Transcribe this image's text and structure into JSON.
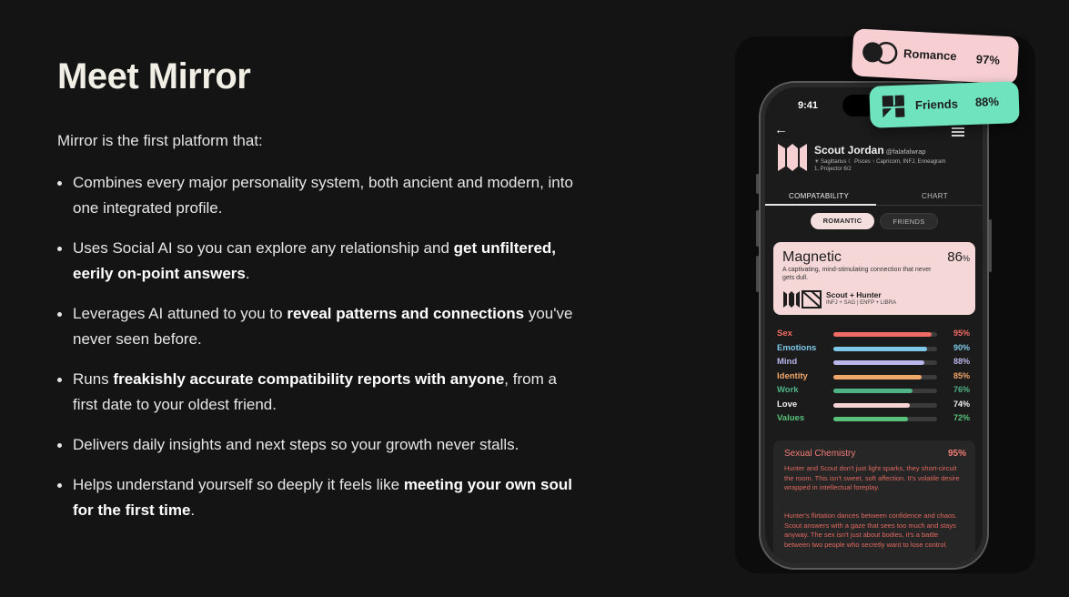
{
  "hero": {
    "title": "Meet Mirror",
    "intro": "Mirror is the first platform that:"
  },
  "bullets": [
    {
      "parts": [
        {
          "text": "Combines every major personality system, both ancient and modern, into one integrated profile.",
          "bold": false
        }
      ]
    },
    {
      "parts": [
        {
          "text": "Uses Social AI so you can explore any relationship and ",
          "bold": false
        },
        {
          "text": "get unfiltered, eerily on-point answers",
          "bold": true
        },
        {
          "text": ".",
          "bold": false
        }
      ]
    },
    {
      "parts": [
        {
          "text": "Leverages AI attuned to you to ",
          "bold": false
        },
        {
          "text": "reveal patterns and connections",
          "bold": true
        },
        {
          "text": " you've never seen before.",
          "bold": false
        }
      ]
    },
    {
      "parts": [
        {
          "text": "Runs ",
          "bold": false
        },
        {
          "text": "freakishly accurate compatibility reports with anyone",
          "bold": true
        },
        {
          "text": ", from a first date to your oldest friend.",
          "bold": false
        }
      ]
    },
    {
      "parts": [
        {
          "text": "Delivers daily insights and next steps so your growth never stalls.",
          "bold": false
        }
      ]
    },
    {
      "parts": [
        {
          "text": "Helps understand yourself so deeply it feels like ",
          "bold": false
        },
        {
          "text": "meeting your own soul for the first time",
          "bold": true
        },
        {
          "text": ".",
          "bold": false
        }
      ]
    }
  ],
  "pills": {
    "romance": {
      "label": "Romance",
      "pct": "97%",
      "color": "#f7cfd3"
    },
    "friends": {
      "label": "Friends",
      "pct": "88%",
      "color": "#6fe3be"
    }
  },
  "phone": {
    "time": "9:41",
    "profile": {
      "name": "Scout Jordan",
      "handle": "@falafalwrap",
      "meta": "☀ Sagittarius ☾ Pisces ↑ Capricorn, INFJ, Enneagram 1, Projector 6/2"
    },
    "tabs": {
      "compatibility": "COMPATABILITY",
      "chart": "CHART"
    },
    "segments": {
      "romantic": "ROMANTIC",
      "friends": "FRIENDS"
    },
    "card": {
      "title": "Magnetic",
      "pct": "86",
      "pct_unit": "%",
      "desc": "A captivating, mind-stimulating connection that never gets dull.",
      "pair": "Scout + Hunter",
      "pair_sub": "INFJ + SAG | ENFP + LIBRA"
    },
    "metrics": [
      {
        "label": "Sex",
        "pct": "95%",
        "value": 95,
        "color": "#f06b63"
      },
      {
        "label": "Emotions",
        "pct": "90%",
        "value": 90,
        "color": "#7ec9ea"
      },
      {
        "label": "Mind",
        "pct": "88%",
        "value": 88,
        "color": "#b9b6ea"
      },
      {
        "label": "Identity",
        "pct": "85%",
        "value": 85,
        "color": "#f1a66a"
      },
      {
        "label": "Work",
        "pct": "76%",
        "value": 76,
        "color": "#4fb386"
      },
      {
        "label": "Love",
        "pct": "74%",
        "value": 74,
        "color": "#f6d4d6"
      },
      {
        "label": "Values",
        "pct": "72%",
        "value": 72,
        "color": "#59c27a"
      }
    ],
    "detail": {
      "title": "Sexual Chemistry",
      "pct": "95%",
      "para1": "Hunter and Scout don't just light sparks, they short-circuit the room. This isn't sweet, soft affection. It's volatile desire wrapped in intellectual foreplay.",
      "para2": "Hunter's flirtation dances between confidence and chaos. Scout answers with a gaze that sees too much and stays anyway. The sex isn't just about bodies, it's a battle between two people who secretly want to lose control."
    }
  }
}
